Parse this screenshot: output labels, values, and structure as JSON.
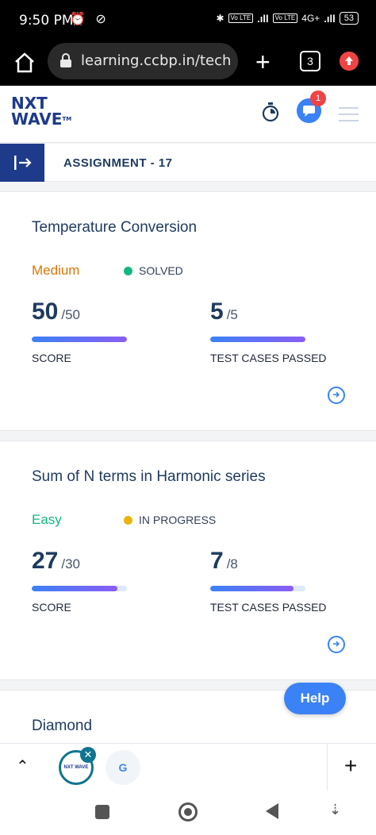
{
  "status_bar": {
    "time": "9:50 PM",
    "network": "4G+",
    "battery": "53"
  },
  "browser": {
    "url": "learning.ccbp.in/tech-",
    "tab_count": "3"
  },
  "header": {
    "logo_line1": "NXT",
    "logo_line2": "WAVE",
    "logo_tm": "TM",
    "notification_count": "1"
  },
  "assignment": {
    "title": "ASSIGNMENT - 17"
  },
  "questions": [
    {
      "title": "Temperature Conversion",
      "difficulty": "Medium",
      "difficulty_color": "#d97706",
      "status": "SOLVED",
      "status_color": "#10b981",
      "score": "50",
      "score_max": "/50",
      "score_fraction": 1.0,
      "score_label": "SCORE",
      "tests": "5",
      "tests_max": "/5",
      "tests_fraction": 1.0,
      "tests_label": "TEST CASES PASSED"
    },
    {
      "title": "Sum of N terms in Harmonic series",
      "difficulty": "Easy",
      "difficulty_color": "#10b981",
      "status": "IN PROGRESS",
      "status_color": "#eab308",
      "score": "27",
      "score_max": "/30",
      "score_fraction": 0.9,
      "score_label": "SCORE",
      "tests": "7",
      "tests_max": "/8",
      "tests_fraction": 0.875,
      "tests_label": "TEST CASES PASSED"
    },
    {
      "title": "Diamond"
    }
  ],
  "help_button": {
    "label": "Help"
  },
  "tab_strip": {
    "thumb_label": "NXT WAVE",
    "g_label": "G"
  }
}
